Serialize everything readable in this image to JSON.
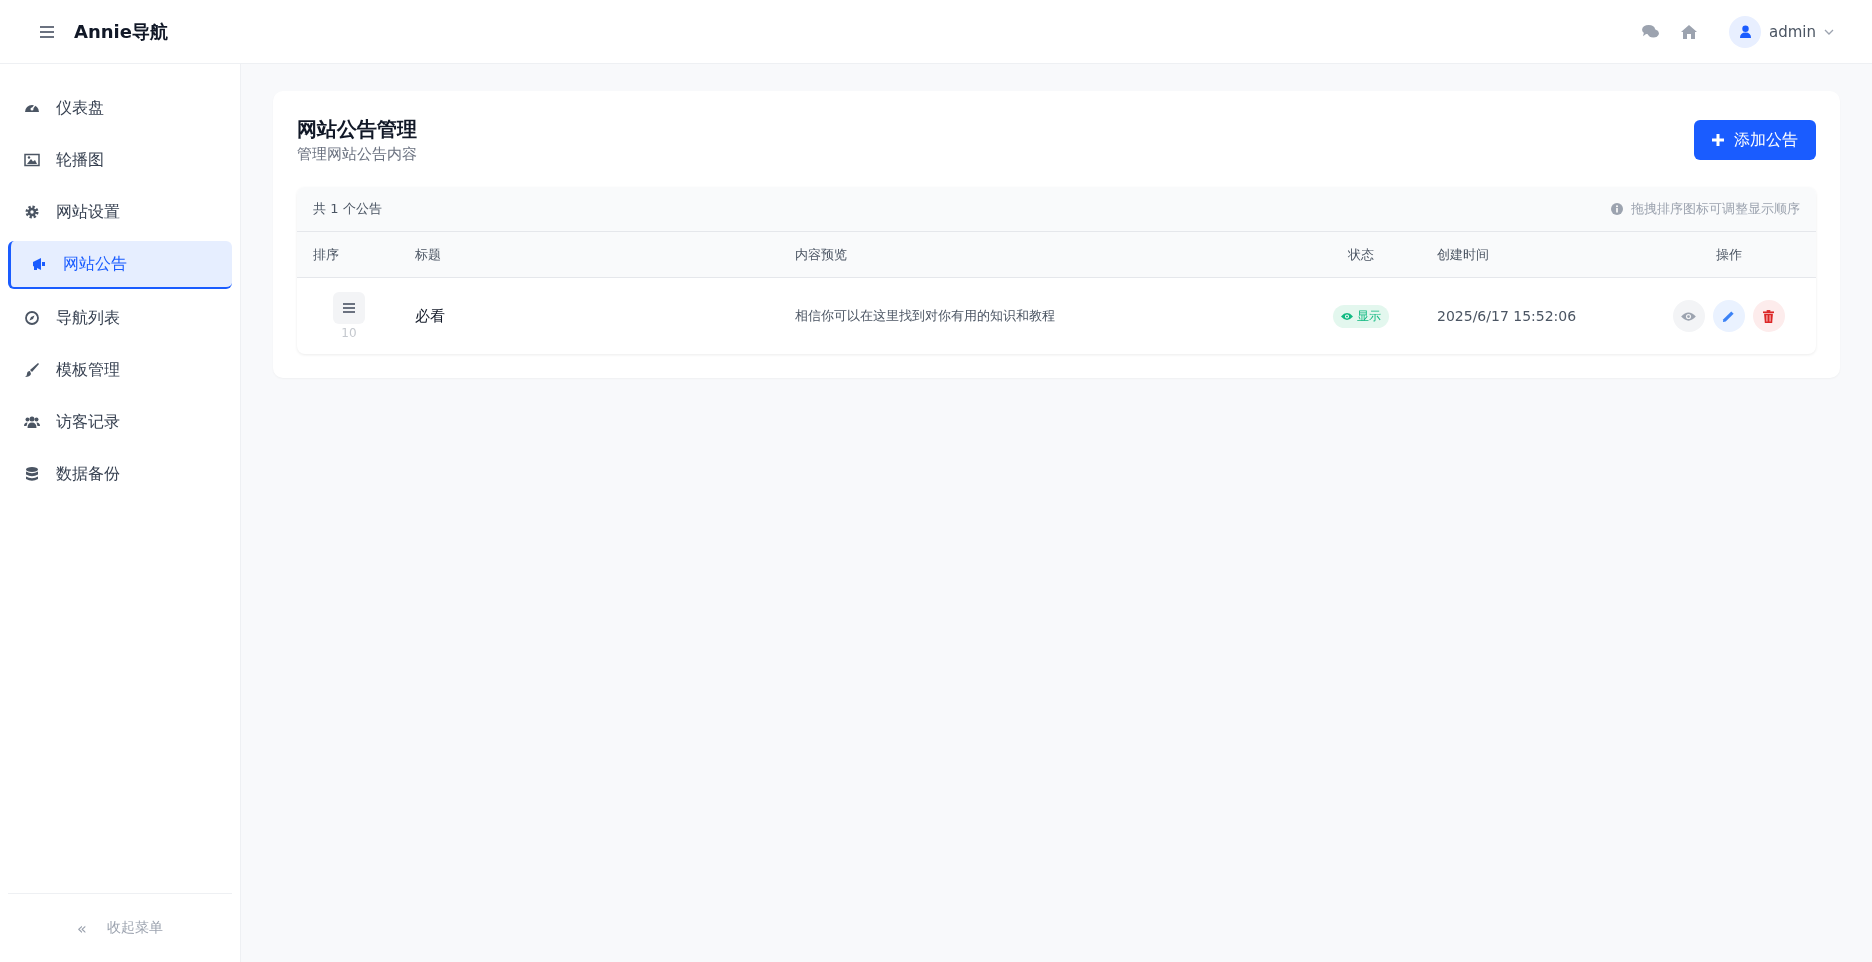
{
  "header": {
    "brand": "Annie导航",
    "user": "admin"
  },
  "sidebar": {
    "items": [
      {
        "label": "仪表盘",
        "selected": false
      },
      {
        "label": "轮播图",
        "selected": false
      },
      {
        "label": "网站设置",
        "selected": false
      },
      {
        "label": "网站公告",
        "selected": true
      },
      {
        "label": "导航列表",
        "selected": false
      },
      {
        "label": "模板管理",
        "selected": false
      },
      {
        "label": "访客记录",
        "selected": false
      },
      {
        "label": "数据备份",
        "selected": false
      }
    ],
    "collapse": {
      "icon": "«",
      "label": "收起菜单"
    }
  },
  "page": {
    "title": "网站公告管理",
    "subtitle": "管理网站公告内容",
    "add_button": "添加公告"
  },
  "table": {
    "count": "共 1 个公告",
    "hint": "拖拽排序图标可调整显示顺序",
    "columns": [
      "排序",
      "标题",
      "内容预览",
      "状态",
      "创建时间",
      "操作"
    ],
    "rows": [
      {
        "order": "10",
        "title": "必看",
        "preview": "相信你可以在这里找到对你有用的知识和教程",
        "status": "显示",
        "visible": true,
        "created": "2025/6/17 15:52:06"
      }
    ]
  }
}
